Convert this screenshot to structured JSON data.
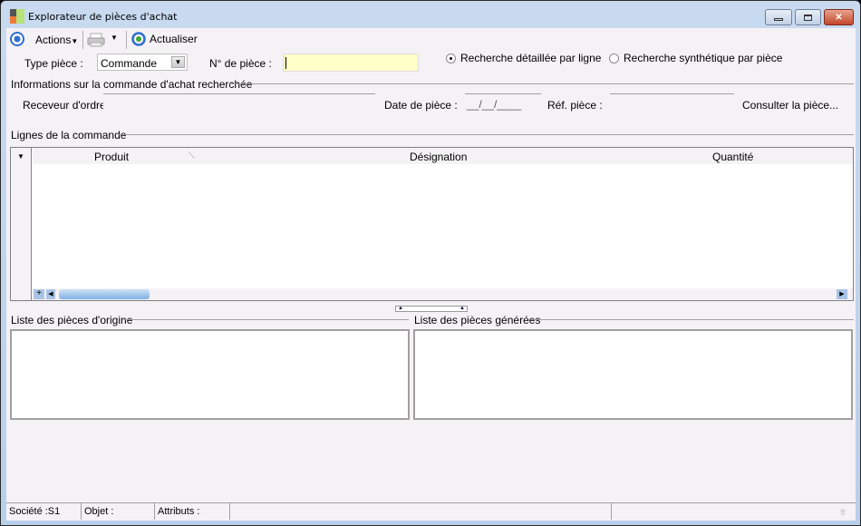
{
  "window": {
    "title": "Explorateur de pièces d'achat"
  },
  "toolbar": {
    "actions_label": "Actions",
    "refresh_label": "Actualiser"
  },
  "filters": {
    "type_label": "Type pièce :",
    "type_value": "Commande",
    "number_label": "N° de pièce :",
    "number_value": "",
    "radio_detailed": "Recherche détaillée par ligne",
    "radio_synthetic": "Recherche synthétique par pièce",
    "selected": "detailed"
  },
  "info": {
    "group_title": "Informations sur la commande d'achat recherchée",
    "receiver_label": "Receveur d'ordre :",
    "date_label": "Date de pièce :",
    "date_value": "__/__/____",
    "ref_label": "Réf. pièce :",
    "consult_link": "Consulter la pièce..."
  },
  "lines": {
    "group_title": "Lignes de la commande",
    "columns": [
      "Produit",
      "Désignation",
      "Quantité"
    ],
    "add_symbol": "+"
  },
  "origin": {
    "title": "Liste des pièces d'origine"
  },
  "generated": {
    "title": "Liste des pièces générées"
  },
  "statusbar": {
    "company": "Société :S1",
    "object": "Objet :",
    "attributes": "Attributs :"
  }
}
